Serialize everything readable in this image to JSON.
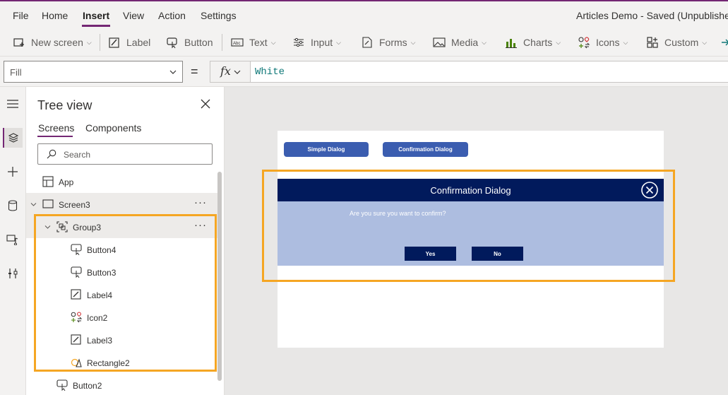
{
  "menu": {
    "items": [
      "File",
      "Home",
      "Insert",
      "View",
      "Action",
      "Settings"
    ],
    "active": "Insert"
  },
  "app_title": "Articles Demo - Saved (Unpublishe",
  "ribbon": {
    "new_screen": "New screen",
    "label": "Label",
    "button": "Button",
    "text": "Text",
    "input": "Input",
    "forms": "Forms",
    "media": "Media",
    "charts": "Charts",
    "icons": "Icons",
    "custom": "Custom"
  },
  "formula": {
    "property": "Fill",
    "equals": "=",
    "fx": "fx",
    "value": "White"
  },
  "tree": {
    "title": "Tree view",
    "tabs": [
      "Screens",
      "Components"
    ],
    "active_tab": "Screens",
    "search_placeholder": "Search",
    "items": [
      {
        "label": "App",
        "icon": "app-icon"
      },
      {
        "label": "Screen3",
        "icon": "screen-icon"
      },
      {
        "label": "Group3",
        "icon": "group-icon"
      },
      {
        "label": "Button4",
        "icon": "button-icon"
      },
      {
        "label": "Button3",
        "icon": "button-icon"
      },
      {
        "label": "Label4",
        "icon": "label-icon"
      },
      {
        "label": "Icon2",
        "icon": "icons-icon"
      },
      {
        "label": "Label3",
        "icon": "label-icon"
      },
      {
        "label": "Rectangle2",
        "icon": "shape-icon"
      },
      {
        "label": "Button2",
        "icon": "button-icon"
      }
    ]
  },
  "canvas": {
    "buttons": [
      "Simple Dialog",
      "Confirmation Dialog"
    ],
    "dialog": {
      "title": "Confirmation Dialog",
      "message": "Are you sure you want to confirm?",
      "yes": "Yes",
      "no": "No"
    }
  },
  "colors": {
    "accent": "#742774",
    "highlight_frame": "#f5a623",
    "dialog_header": "#011a5c",
    "dialog_body": "#adbde0",
    "canvas_button": "#3b5db0"
  }
}
